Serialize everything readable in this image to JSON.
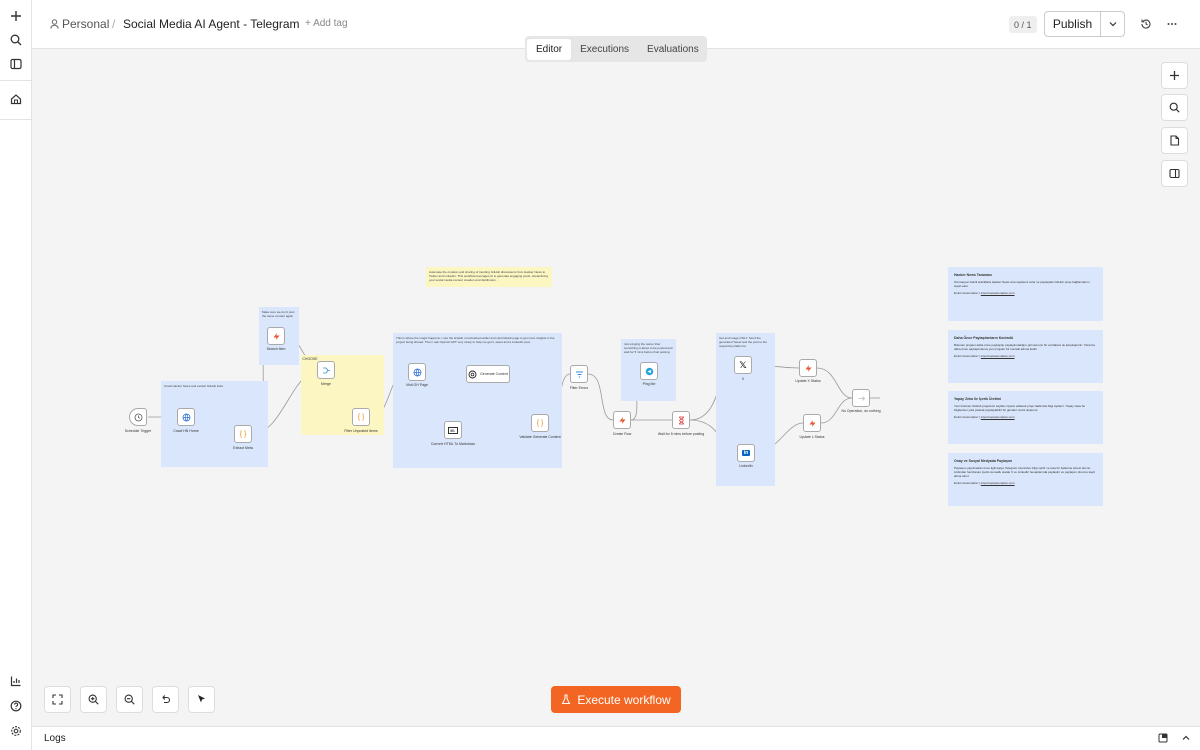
{
  "sidebar": {
    "icons": [
      "plus-icon",
      "search-icon",
      "panel-icon",
      "home-icon",
      "chart-icon",
      "help-icon",
      "settings-icon"
    ]
  },
  "header": {
    "project": "Personal",
    "separator": "/",
    "workflow_name": "Social Media AI Agent - Telegram",
    "add_tag": "+ Add tag",
    "counter": "0 / 1",
    "publish": "Publish"
  },
  "tabs": [
    "Editor",
    "Executions",
    "Evaluations"
  ],
  "execute_button": "Execute workflow",
  "logs": {
    "label": "Logs"
  },
  "canvas": {
    "notes": {
      "intro": "Automate the curation and sharing of trending GitHub discussions from Hacker News to Twitter and LinkedIn. This workflow leverages AI to generate engaging posts, streamlining your social media content creation and distribution.",
      "crawl": "Crawl Hacker News and extract GitHub links",
      "check": "Make sure we don't post the same content again",
      "magic": "This is where the magic happens. I use the GitHub url extracted earlier and visit GitHub page to get more insights in the project being shared. Then I ask OpenAI GPT very nicely to help me get it, tweet and a LinkedIn post.",
      "ping": "Just pinging the owner that something is about to be posted and wait for 5 mins before final posting",
      "post": "Get and image ONLY. Send the generated Tweet and the post to the respective platforms"
    },
    "nodes": {
      "schedule": "Schedule Trigger",
      "crawl_hn": "Crawl HN Home",
      "extract": "Extract Meta",
      "search": "Search Item",
      "merge": "Merge",
      "filter_unposted": "Filter Unposted Items",
      "visit_gh": "Visit GH Page",
      "convert": "Convert HTML To Markdown",
      "generate": "Generate Content",
      "validate": "Validate Generate Content",
      "filter_errors": "Filter Errors",
      "create_row": "Create Row",
      "ping": "Ping Me",
      "wait": "Wait for 5 mins before posting",
      "x": "X",
      "linkedin": "LinkedIn",
      "update_x": "Update X Status",
      "update_l": "Update L Status",
      "noop": "No Operation, do nothing",
      "merge_mode": "CHOOSE"
    },
    "stickies": [
      {
        "title": "Hacker News Taraması",
        "body": "Otomasyon belirli aralıklarla Hacker News ana sayfasını tarar ve paylaşılan GitHub proje bağlantılarını tespit eder.",
        "footer": "Emirin Automation | "
      },
      {
        "title": "Daha Önce Paylaşılanların Kontrolü",
        "body": "Bulunan projeler daha önce paylaşılıp paylaşılmadığını görmek için bir veritabanı ile karşılaştırılır. Yalnızca daha önce paylaşılmamış yeni projeler bir sonraki adıma iletilir.",
        "footer": "Emirin Automation | "
      },
      {
        "title": "Yapay Zeka ile İçerik Üretimi",
        "body": "Yeni bulunan GitHub projesinin sayfası ziyaret edilerek proje hakkında bilgi toplanır. Yapay zeka bu bilgilerden yola çıkarak paylaşılabilir bir gönderi metni oluşturur.",
        "footer": "Emirin Automation | "
      },
      {
        "title": "Onay ve Sosyal Medyada Paylaşım",
        "body": "Paylaşım yapılmadan önce ilgili kişiye Telegram üzerinden bilgi verilir ve kısa bir bekleme süresi tanınır. Ardından hazırlanan içerik otomatik olarak X ve LinkedIn hesaplarında paylaşılır ve paylaşım durumu kayıt altına alınır.",
        "footer": "Emirin Automation | "
      }
    ],
    "sticky_link": "intercrestautomation.com"
  },
  "colors": {
    "accent": "#f26522",
    "note_blue": "#d9e6fb",
    "note_yellow": "#fbf6c2"
  }
}
